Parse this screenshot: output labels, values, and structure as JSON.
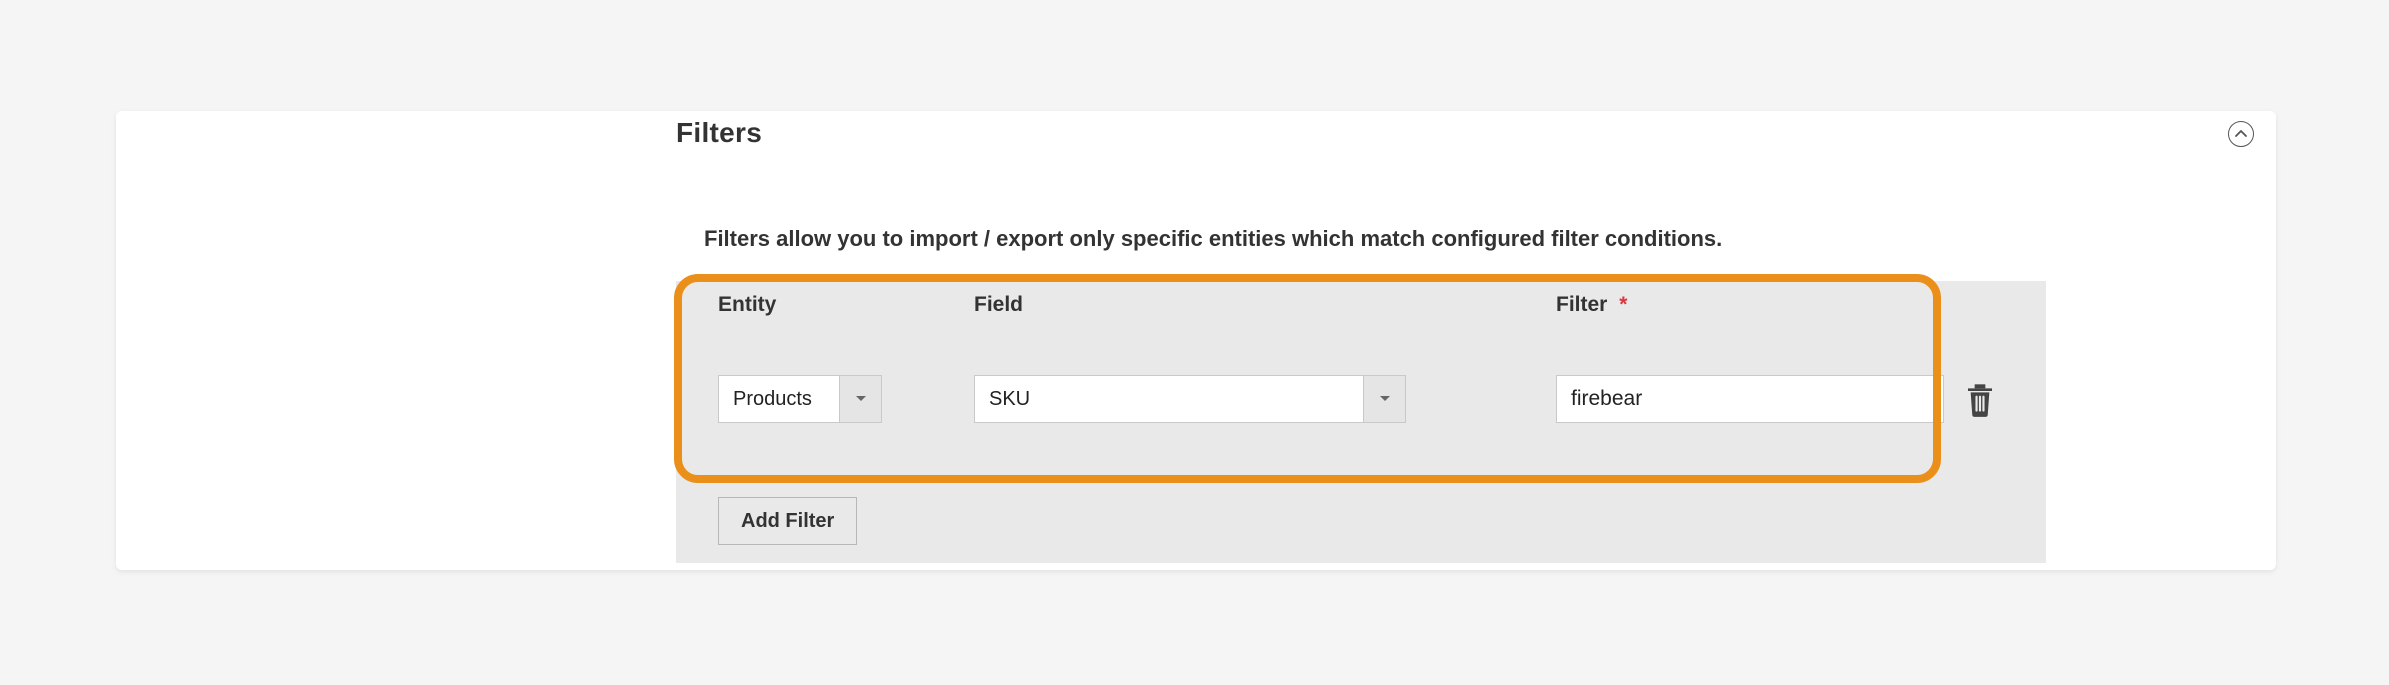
{
  "panel": {
    "title": "Filters",
    "description": "Filters allow you to import / export only specific entities which match configured filter conditions."
  },
  "headers": {
    "entity": "Entity",
    "field": "Field",
    "filter": "Filter",
    "required_mark": "*"
  },
  "row": {
    "entity": "Products",
    "field": "SKU",
    "filter_value": "firebear"
  },
  "buttons": {
    "add_filter": "Add Filter"
  }
}
